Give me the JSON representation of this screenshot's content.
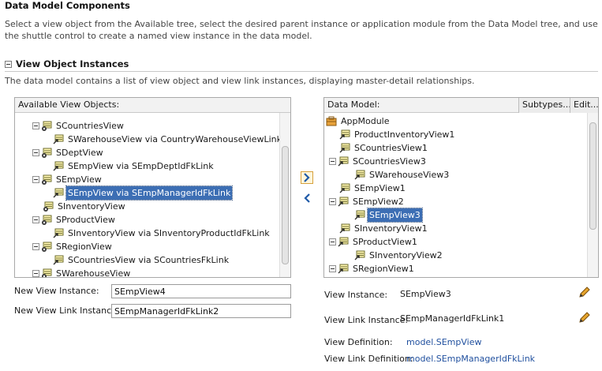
{
  "header": {
    "title": "Data Model Components",
    "description": "Select a view object from the Available tree, select the desired parent instance or application module from the Data Model tree, and use the shuttle control to create a named view instance in the data model."
  },
  "section": {
    "title": "View Object Instances",
    "description": "The data model contains a list of view object and view link instances, displaying master-detail relationships."
  },
  "available": {
    "header": "Available View Objects:",
    "rows": [
      {
        "label": "SCountriesView"
      },
      {
        "label": "SWarehouseView via CountryWarehouseViewLink"
      },
      {
        "label": "SDeptView"
      },
      {
        "label": "SEmpView via SEmpDeptIdFkLink"
      },
      {
        "label": "SEmpView"
      },
      {
        "label": "SEmpView via SEmpManagerIdFkLink"
      },
      {
        "label": "SInventoryView"
      },
      {
        "label": "SProductView"
      },
      {
        "label": "SInventoryView via SInventoryProductIdFkLink"
      },
      {
        "label": "SRegionView"
      },
      {
        "label": "SCountriesView via SCountriesFkLink"
      },
      {
        "label": "SWarehouseView"
      }
    ]
  },
  "datamodel": {
    "header": "Data Model:",
    "subtypes_label": "Subtypes...",
    "edit_label": "Edit...",
    "rows": [
      {
        "label": "AppModule"
      },
      {
        "label": "ProductInventoryView1"
      },
      {
        "label": "SCountriesView1"
      },
      {
        "label": "SCountriesView3"
      },
      {
        "label": "SWarehouseView3"
      },
      {
        "label": "SEmpView1"
      },
      {
        "label": "SEmpView2"
      },
      {
        "label": "SEmpView3"
      },
      {
        "label": "SInventoryView1"
      },
      {
        "label": "SProductView1"
      },
      {
        "label": "SInventoryView2"
      },
      {
        "label": "SRegionView1"
      }
    ]
  },
  "form": {
    "new_instance_label": "New View Instance:",
    "new_instance_value": "SEmpView4",
    "new_link_label": "New View Link Instance:",
    "new_link_value": "SEmpManagerIdFkLink2"
  },
  "details": {
    "view_instance_label": "View Instance:",
    "view_instance_value": "SEmpView3",
    "view_link_instance_label": "View Link Instance:",
    "view_link_instance_value": "SEmpManagerIdFkLink1",
    "view_definition_label": "View Definition:",
    "view_definition_value": "model.SEmpView",
    "view_link_definition_label": "View Link Definition:",
    "view_link_definition_value": "model.SEmpManagerIdFkLink"
  },
  "colors": {
    "selection": "#3c6eb4",
    "link": "#1f4f9e",
    "accent": "#d7a13c"
  }
}
